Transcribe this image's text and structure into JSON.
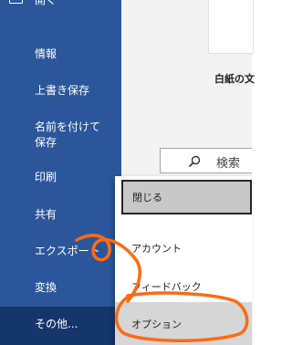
{
  "sidebar": {
    "items": [
      {
        "label": "開く"
      },
      {
        "label": "情報"
      },
      {
        "label": "上書き保存"
      },
      {
        "label": "名前を付けて保存"
      },
      {
        "label": "印刷"
      },
      {
        "label": "共有"
      },
      {
        "label": "エクスポート"
      },
      {
        "label": "変換"
      },
      {
        "label": "その他..."
      }
    ]
  },
  "main": {
    "template_title": "白紙の文",
    "search": {
      "placeholder": "検索"
    }
  },
  "menu": {
    "items": [
      {
        "label": "閉じる"
      },
      {
        "label": "アカウント"
      },
      {
        "label": "フィードバック"
      },
      {
        "label": "オプション"
      }
    ]
  },
  "colors": {
    "sidebar": "#2b579a",
    "sidebar_active": "#14366b",
    "annotation": "#ff6a13"
  }
}
